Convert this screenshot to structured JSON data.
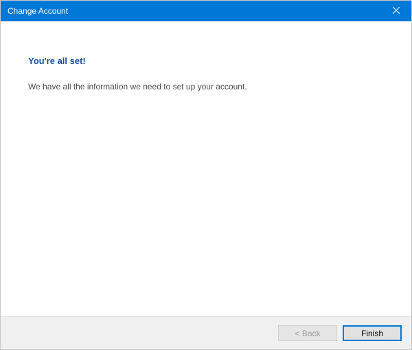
{
  "titlebar": {
    "title": "Change Account"
  },
  "main": {
    "heading": "You're all set!",
    "description": "We have all the information we need to set up your account."
  },
  "footer": {
    "back_label": "< Back",
    "finish_label": "Finish"
  }
}
